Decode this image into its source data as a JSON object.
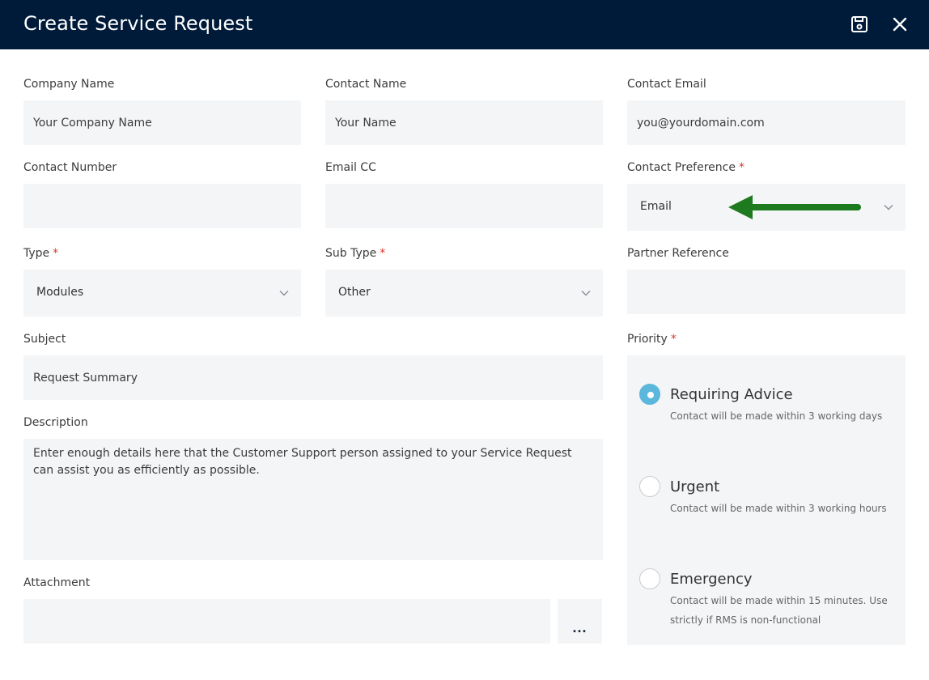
{
  "header": {
    "title": "Create Service Request",
    "save_icon": "save-icon",
    "close_icon": "close-icon"
  },
  "form": {
    "company_name": {
      "label": "Company Name",
      "placeholder": "Your Company Name"
    },
    "contact_name": {
      "label": "Contact Name",
      "placeholder": "Your Name"
    },
    "contact_email": {
      "label": "Contact Email",
      "placeholder": "you@yourdomain.com"
    },
    "contact_number": {
      "label": "Contact Number",
      "value": ""
    },
    "email_cc": {
      "label": "Email CC",
      "value": ""
    },
    "contact_preference": {
      "label": "Contact Preference",
      "required": "*",
      "value": "Email"
    },
    "type": {
      "label": "Type",
      "required": "*",
      "value": "Modules"
    },
    "sub_type": {
      "label": "Sub Type",
      "required": "*",
      "value": "Other"
    },
    "partner_reference": {
      "label": "Partner Reference",
      "value": ""
    },
    "subject": {
      "label": "Subject",
      "placeholder": "Request Summary"
    },
    "description": {
      "label": "Description",
      "placeholder": "Enter enough details here that the Customer Support person assigned to your Service Request can assist you as efficiently as possible."
    },
    "attachment": {
      "label": "Attachment",
      "value": "",
      "browse_label": "..."
    },
    "priority": {
      "label": "Priority",
      "required": "*",
      "options": [
        {
          "title": "Requiring Advice",
          "desc": "Contact will be made within 3 working days",
          "checked": true
        },
        {
          "title": "Urgent",
          "desc": "Contact will be made within 3 working hours",
          "checked": false
        },
        {
          "title": "Emergency",
          "desc": "Contact will be made within 15 minutes. Use strictly if RMS is non-functional",
          "checked": false
        }
      ]
    }
  },
  "colors": {
    "header_bg": "#001b3a",
    "field_bg": "#f4f5f7",
    "required": "#d9342b",
    "radio_checked": "#5bb8dc",
    "annotation_arrow": "#1e7a1e"
  }
}
